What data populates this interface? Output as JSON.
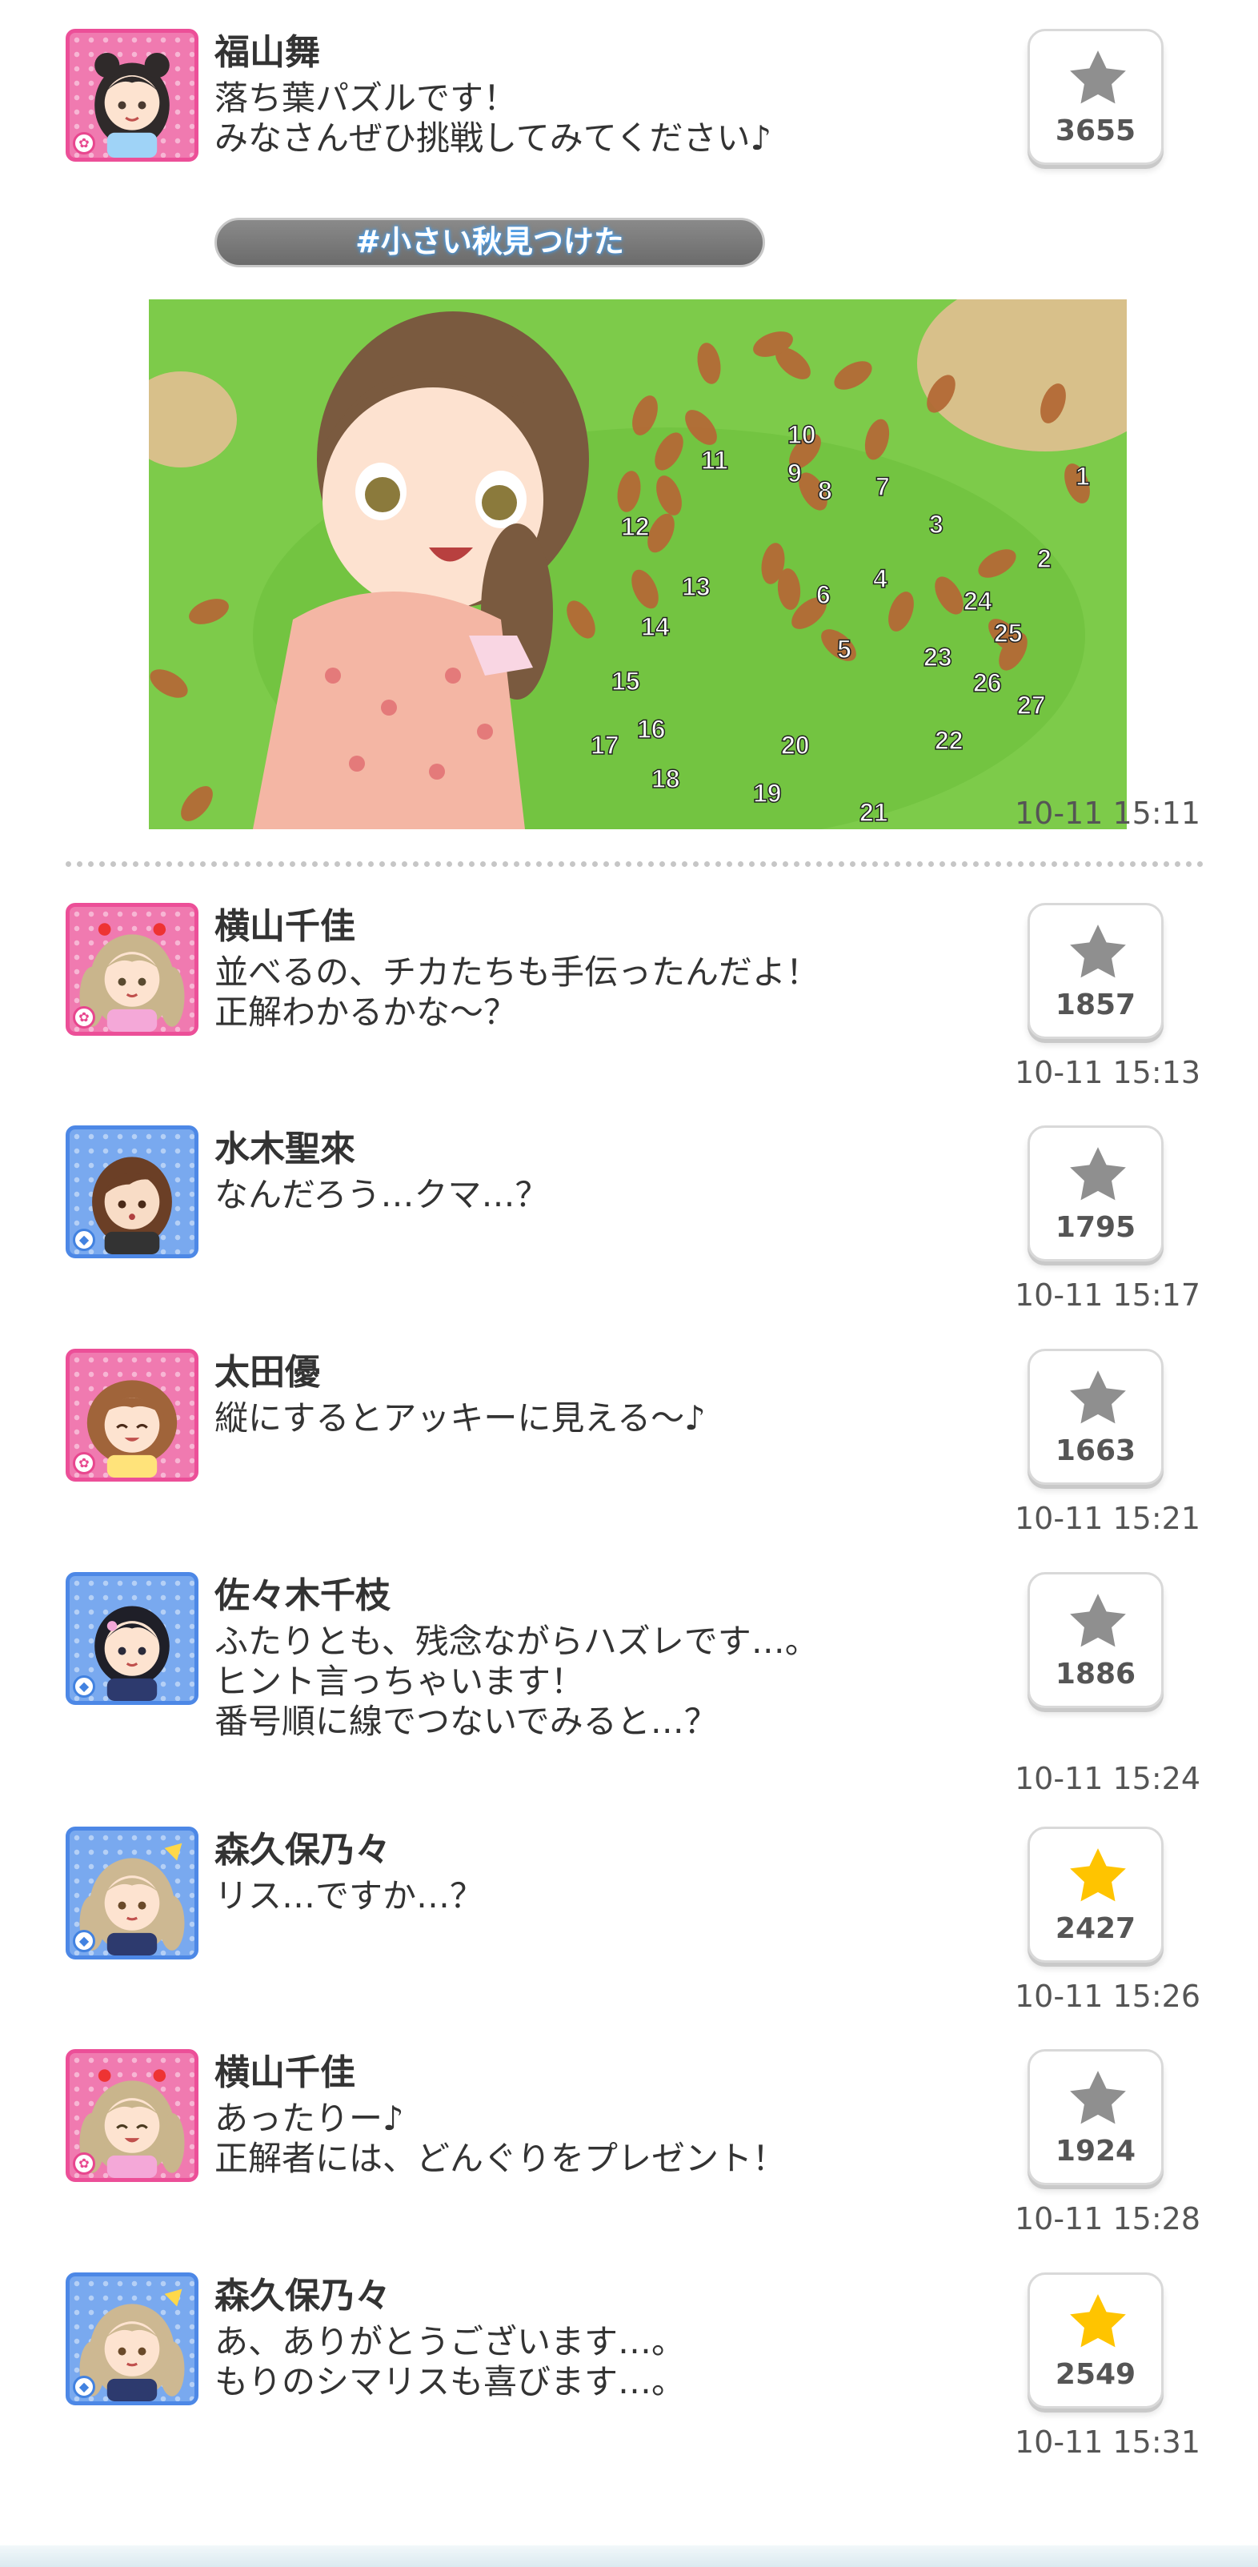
{
  "posts": [
    {
      "name": "福山舞",
      "message": "落ち葉パズルです！\nみなさんぜひ挑戦してみてください♪",
      "hashtag": "#小さい秋見つけた",
      "likes": "3655",
      "liked": false,
      "time": "10-11 15:11",
      "avatar_type": "cute",
      "image_numbers": [
        "1",
        "2",
        "3",
        "4",
        "5",
        "6",
        "7",
        "8",
        "9",
        "10",
        "11",
        "12",
        "13",
        "14",
        "15",
        "16",
        "17",
        "18",
        "19",
        "20",
        "21",
        "22",
        "23",
        "24",
        "25",
        "26",
        "27"
      ]
    },
    {
      "name": "横山千佳",
      "message": "並べるの、チカたちも手伝ったんだよ！\n正解わかるかな～？",
      "likes": "1857",
      "liked": false,
      "time": "10-11 15:13",
      "avatar_type": "cute"
    },
    {
      "name": "水木聖來",
      "message": "なんだろう…クマ…？",
      "likes": "1795",
      "liked": false,
      "time": "10-11 15:17",
      "avatar_type": "cool"
    },
    {
      "name": "太田優",
      "message": "縦にするとアッキーに見える～♪",
      "likes": "1663",
      "liked": false,
      "time": "10-11 15:21",
      "avatar_type": "cute"
    },
    {
      "name": "佐々木千枝",
      "message": "ふたりとも、残念ながらハズレです…。\nヒント言っちゃいます！\n番号順に線でつないでみると…？",
      "likes": "1886",
      "liked": false,
      "time": "10-11 15:24",
      "avatar_type": "cool"
    },
    {
      "name": "森久保乃々",
      "message": "リス…ですか…？",
      "likes": "2427",
      "liked": true,
      "time": "10-11 15:26",
      "avatar_type": "cool"
    },
    {
      "name": "横山千佳",
      "message": "あったりー♪\n正解者には、どんぐりをプレゼント！",
      "likes": "1924",
      "liked": false,
      "time": "10-11 15:28",
      "avatar_type": "cute"
    },
    {
      "name": "森久保乃々",
      "message": "あ、ありがとうございます…。\nもりのシマリスも喜びます…。",
      "likes": "2549",
      "liked": true,
      "time": "10-11 15:31",
      "avatar_type": "cool"
    }
  ],
  "icons": {
    "like": "star-icon",
    "cute_badge": "flower-badge-icon",
    "cool_badge": "diamond-badge-icon"
  },
  "colors": {
    "liked_star": "#ffc400",
    "unliked_star": "#8f8f8f",
    "cute": "#ec4f98",
    "cool": "#4d88e6"
  }
}
